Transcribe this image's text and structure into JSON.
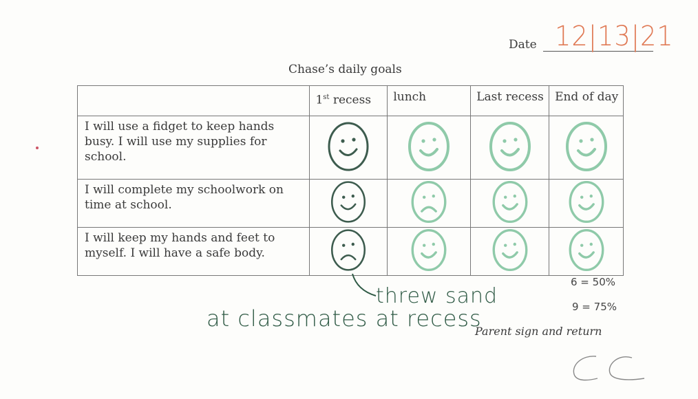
{
  "header": {
    "date_label": "Date",
    "date_value": "12|13|21",
    "title": "Chase’s daily goals"
  },
  "table": {
    "columns": [
      {
        "label": "",
        "sup": ""
      },
      {
        "label": "1",
        "sup": "st",
        "rest": " recess"
      },
      {
        "label": "lunch"
      },
      {
        "label": "Last recess"
      },
      {
        "label": "End of day"
      }
    ],
    "rows": [
      {
        "goal": "I will use a fidget to keep hands busy. I will use my supplies for school.",
        "faces": [
          "smile",
          "smile",
          "smile",
          "smile"
        ]
      },
      {
        "goal": "I will complete my schoolwork on time at school.",
        "faces": [
          "smile",
          "frown",
          "smile",
          "smile"
        ]
      },
      {
        "goal": "I will keep my hands and feet to myself. I will have a safe body.",
        "faces": [
          "frown",
          "smile",
          "smile",
          "smile"
        ]
      }
    ]
  },
  "scoring": {
    "line1": "6 = 50%",
    "line2": "9 = 75%"
  },
  "footer": {
    "parent_sign": "Parent sign and return",
    "signature": "CC"
  },
  "handwritten_note": {
    "line1": "threw sand",
    "line2": "at classmates at recess"
  },
  "colors": {
    "dark_marker": "#3d5c4e",
    "light_marker": "#8fcaa9",
    "date_ink": "#e07a55",
    "note_ink": "#2f5a45"
  }
}
